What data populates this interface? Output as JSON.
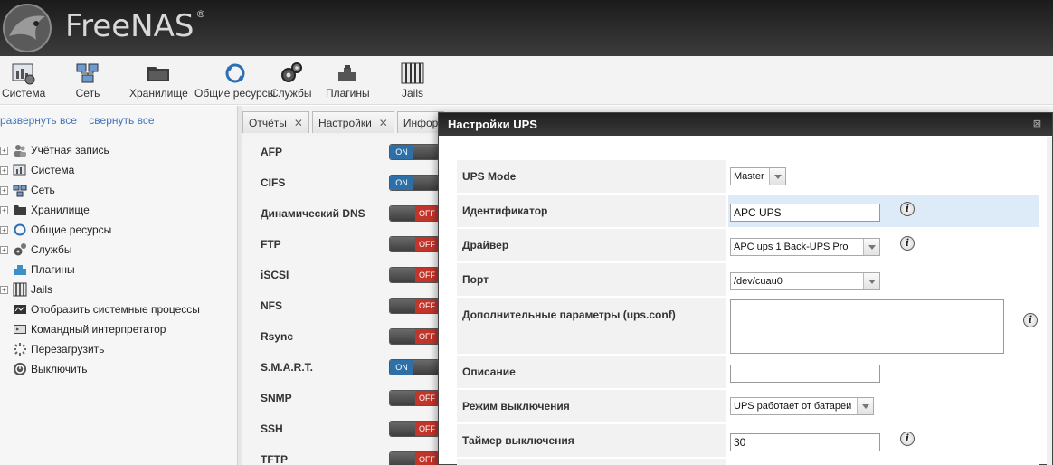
{
  "app": {
    "logo_text": "FreeNAS",
    "logo_reg": "®"
  },
  "toolbar": {
    "items": [
      {
        "label": "Система",
        "icon": "system-icon"
      },
      {
        "label": "Сеть",
        "icon": "network-icon"
      },
      {
        "label": "Хранилище",
        "icon": "storage-icon"
      },
      {
        "label": "Общие ресурсы",
        "icon": "shares-icon"
      },
      {
        "label": "Службы",
        "icon": "services-icon"
      },
      {
        "label": "Плагины",
        "icon": "plugins-icon"
      },
      {
        "label": "Jails",
        "icon": "jails-icon"
      }
    ]
  },
  "tree": {
    "expand_all": "развернуть все",
    "collapse_all": "свернуть все",
    "items": [
      {
        "label": "Учётная запись",
        "expandable": true
      },
      {
        "label": "Система",
        "expandable": true
      },
      {
        "label": "Сеть",
        "expandable": true
      },
      {
        "label": "Хранилище",
        "expandable": true
      },
      {
        "label": "Общие ресурсы",
        "expandable": true
      },
      {
        "label": "Службы",
        "expandable": true
      },
      {
        "label": "Плагины",
        "expandable": false
      },
      {
        "label": "Jails",
        "expandable": true
      },
      {
        "label": "Отобразить системные процессы",
        "expandable": false
      },
      {
        "label": "Командный интерпретатор",
        "expandable": false
      },
      {
        "label": "Перезагрузить",
        "expandable": false
      },
      {
        "label": "Выключить",
        "expandable": false
      }
    ]
  },
  "tabs": [
    {
      "label": "Отчёты",
      "close": "✕"
    },
    {
      "label": "Настройки",
      "close": "✕"
    },
    {
      "label": "Инфор",
      "close": ""
    }
  ],
  "services": [
    {
      "name": "AFP",
      "state": "ON"
    },
    {
      "name": "CIFS",
      "state": "ON"
    },
    {
      "name": "Динамический DNS",
      "state": "OFF"
    },
    {
      "name": "FTP",
      "state": "OFF"
    },
    {
      "name": "iSCSI",
      "state": "OFF"
    },
    {
      "name": "NFS",
      "state": "OFF"
    },
    {
      "name": "Rsync",
      "state": "OFF"
    },
    {
      "name": "S.M.A.R.T.",
      "state": "ON"
    },
    {
      "name": "SNMP",
      "state": "OFF"
    },
    {
      "name": "SSH",
      "state": "OFF"
    },
    {
      "name": "TFTP",
      "state": "OFF"
    }
  ],
  "dialog": {
    "title": "Настройки UPS",
    "close": "⊠",
    "fields": {
      "ups_mode": {
        "label": "UPS Mode",
        "value": "Master"
      },
      "identifier": {
        "label": "Идентификатор",
        "value": "APC UPS"
      },
      "driver": {
        "label": "Драйвер",
        "value": "APC ups 1 Back-UPS Pro"
      },
      "port": {
        "label": "Порт",
        "value": "/dev/cuau0"
      },
      "extra": {
        "label": "Дополнительные параметры (ups.conf)",
        "value": ""
      },
      "description": {
        "label": "Описание",
        "value": ""
      },
      "shutdown_mode": {
        "label": "Режим выключения",
        "value": "UPS работает от батареи"
      },
      "shutdown_timer": {
        "label": "Таймер выключения",
        "value": "30"
      }
    },
    "info_glyph": "i"
  }
}
